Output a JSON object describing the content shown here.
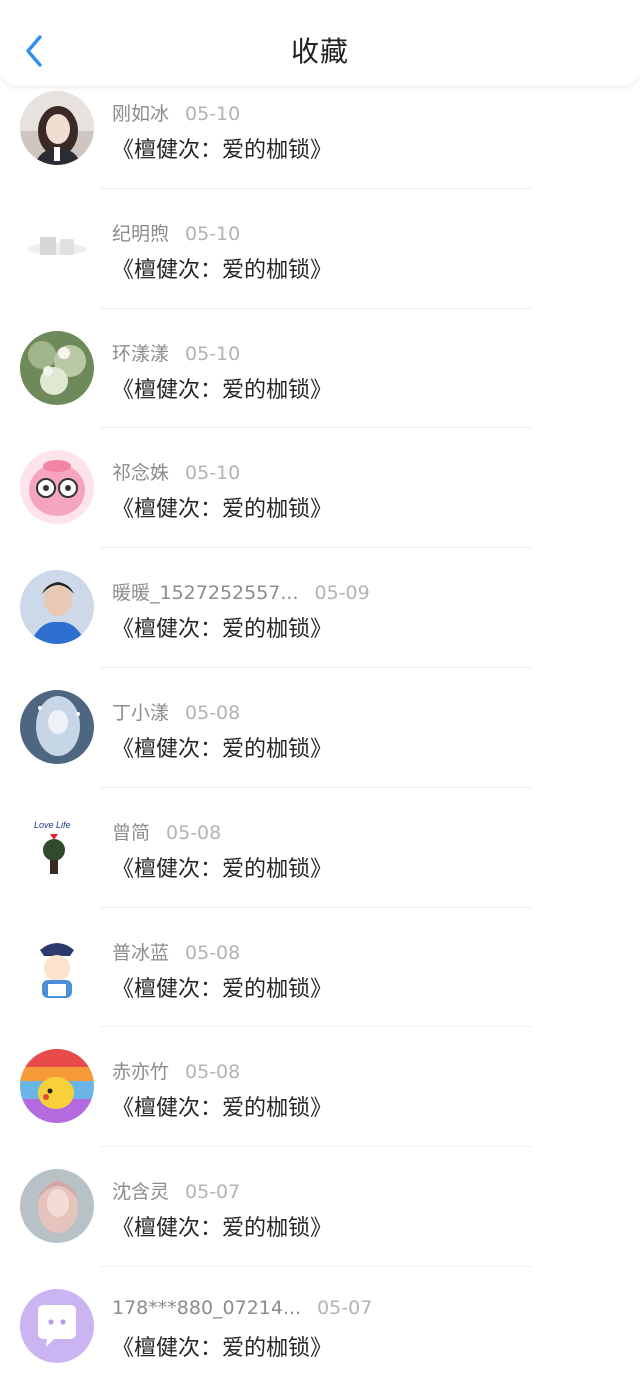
{
  "header": {
    "title": "收藏",
    "back_icon": "chevron-left-icon",
    "accent_color": "#2f8ff0"
  },
  "favorites": [
    {
      "user": "刚如冰",
      "date": "05-10",
      "title": "《檀健次：爱的枷锁》"
    },
    {
      "user": "纪明煦",
      "date": "05-10",
      "title": "《檀健次：爱的枷锁》"
    },
    {
      "user": "环漾漾",
      "date": "05-10",
      "title": "《檀健次：爱的枷锁》"
    },
    {
      "user": "祁念姝",
      "date": "05-10",
      "title": "《檀健次：爱的枷锁》"
    },
    {
      "user": "暖暖_1527252557...",
      "date": "05-09",
      "title": "《檀健次：爱的枷锁》"
    },
    {
      "user": "丁小漾",
      "date": "05-08",
      "title": "《檀健次：爱的枷锁》"
    },
    {
      "user": "曾简",
      "date": "05-08",
      "title": "《檀健次：爱的枷锁》",
      "avatar_text": "Love Life"
    },
    {
      "user": "普冰蓝",
      "date": "05-08",
      "title": "《檀健次：爱的枷锁》"
    },
    {
      "user": "赤亦竹",
      "date": "05-08",
      "title": "《檀健次：爱的枷锁》"
    },
    {
      "user": "沈含灵",
      "date": "05-07",
      "title": "《檀健次：爱的枷锁》"
    },
    {
      "user": "178***880_07214...",
      "date": "05-07",
      "title": "《檀健次：爱的枷锁》"
    }
  ]
}
